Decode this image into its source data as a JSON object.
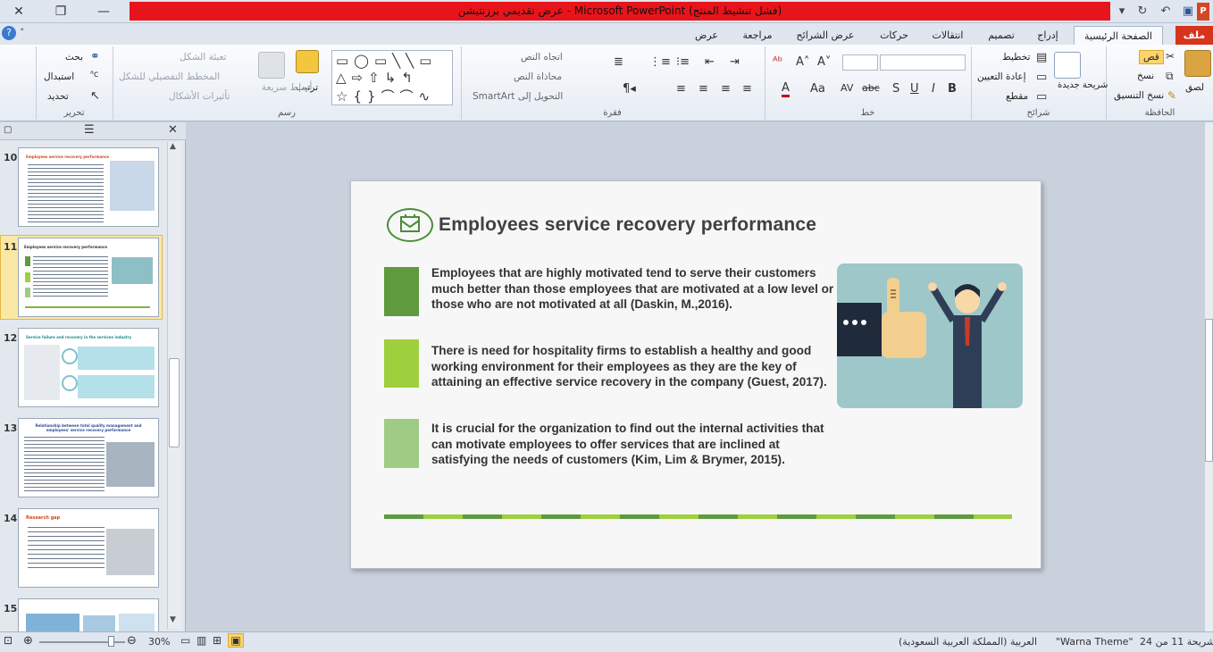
{
  "window": {
    "title": "عرض تقديمي برزنتيشن - Microsoft PowerPoint (فشل تنشيط المنتج)"
  },
  "tabs": [
    {
      "label": "ملف"
    },
    {
      "label": "الصفحة الرئيسية"
    },
    {
      "label": "إدراج"
    },
    {
      "label": "تصميم"
    },
    {
      "label": "انتقالات"
    },
    {
      "label": "حركات"
    },
    {
      "label": "عرض الشرائح"
    },
    {
      "label": "مراجعة"
    },
    {
      "label": "عرض"
    }
  ],
  "ribbon": {
    "clipboard": {
      "label": "الحافظة",
      "paste": "لصق",
      "cut": "قص",
      "copy": "نسخ",
      "format_painter": "نسخ التنسيق"
    },
    "slides": {
      "label": "شرائح",
      "new_slide": "شريحة جديدة",
      "layout": "تخطيط",
      "reset": "إعادة التعيين",
      "section": "مقطع"
    },
    "font": {
      "label": "خط",
      "bold": "B",
      "italic": "I",
      "underline": "U",
      "strike": "abc",
      "shadow": "S",
      "spacing": "AV",
      "case": "Aa",
      "color": "A"
    },
    "paragraph": {
      "label": "فقرة",
      "text_direction": "اتجاه النص",
      "align_text": "محاذاة النص",
      "convert_smartart": "التحويل إلى SmartArt"
    },
    "drawing": {
      "label": "رسم",
      "arrange": "ترتيب",
      "quick_styles": "أنماط سريعة",
      "shape_fill": "تعبئة الشكل",
      "shape_outline": "المخطط التفصيلي للشكل",
      "shape_effects": "تأثيرات الأشكال"
    },
    "editing": {
      "label": "تحرير",
      "find": "بحث",
      "replace": "استبدال",
      "select": "تحديد"
    }
  },
  "thumbnails": [
    {
      "num": "10",
      "title": "Employees service recovery performance"
    },
    {
      "num": "11",
      "title": "Employees service recovery performance"
    },
    {
      "num": "12",
      "title": "Service failure and recovery in the services industry"
    },
    {
      "num": "13",
      "title": "Relationship between total quality management and employees' service recovery performance"
    },
    {
      "num": "14",
      "title": "Research gap"
    },
    {
      "num": "15",
      "title": ""
    }
  ],
  "slide": {
    "title": "Employees  service  recovery  performance",
    "bullets": [
      {
        "text": "Employees that are highly motivated tend to serve their customers much  better than those employees that are motivated at a low level or those who are not motivated at all  (Daskin, M.,2016)."
      },
      {
        "text": "There is need for hospitality firms  to establish a healthy and good working environment for their employees as they are the key of attaining an  effective service recovery in the company  (Guest, 2017)."
      },
      {
        "text": "It is crucial for the organization to find out the internal activities that can motivate employees to offer services that are inclined at satisfying  the needs of customers (Kim, Lim & Brymer, 2015)."
      }
    ]
  },
  "status": {
    "slide_info": "شريحة 11 من 24",
    "theme": "\"Warna Theme\"",
    "language": "العربية (المملكة العربية السعودية)",
    "zoom": "30%"
  },
  "colors": {
    "title_red": "#e8141c",
    "green_dark": "#5f9a3e",
    "green_light": "#9ecf3d",
    "green_pale": "#9fcc84"
  }
}
